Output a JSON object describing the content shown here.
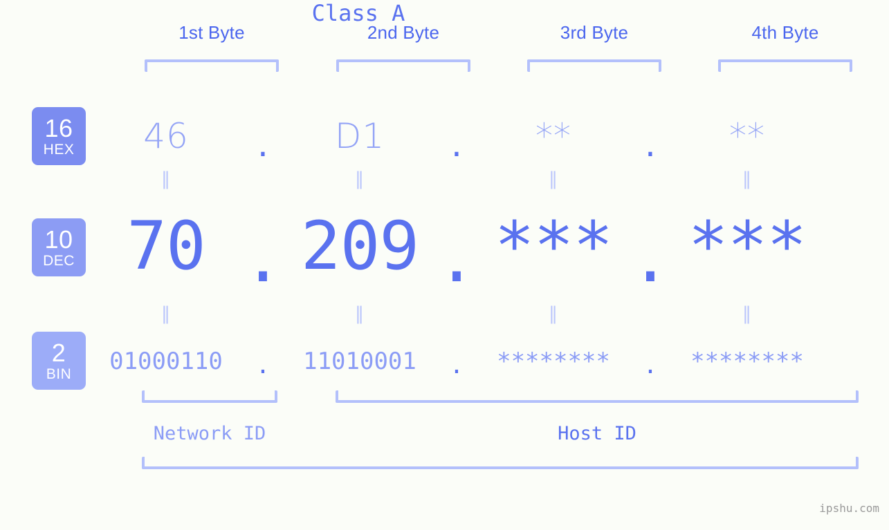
{
  "background_color": "#fbfdf8",
  "accent_colors": {
    "strong_blue": "#5a72ef",
    "mid_blue": "#8b9cf6",
    "light_blue": "#b3c0fb",
    "badge_hex": "#7b8cf0",
    "badge_dec": "#8c9cf4",
    "badge_bin": "#9cacf8",
    "watermark_gray": "#9a9a9a"
  },
  "byte_headers": [
    {
      "label": "1st Byte"
    },
    {
      "label": "2nd Byte"
    },
    {
      "label": "3rd Byte"
    },
    {
      "label": "4th Byte"
    }
  ],
  "bases": [
    {
      "id": "hex",
      "number": "16",
      "name": "HEX"
    },
    {
      "id": "dec",
      "number": "10",
      "name": "DEC"
    },
    {
      "id": "bin",
      "number": "2",
      "name": "BIN"
    }
  ],
  "rows": {
    "hex": {
      "octets": [
        "46",
        "D1",
        "**",
        "**"
      ],
      "separator": "."
    },
    "dec": {
      "octets": [
        "70",
        "209",
        "***",
        "***"
      ],
      "separator": "."
    },
    "bin": {
      "octets": [
        "01000110",
        "11010001",
        "********",
        "********"
      ],
      "separator": "."
    }
  },
  "equality_marks": {
    "glyph": "‖",
    "count_per_row": 4
  },
  "id_labels": {
    "network_id": "Network ID",
    "host_id": "Host ID",
    "class": "Class A"
  },
  "watermark": "ipshu.com"
}
